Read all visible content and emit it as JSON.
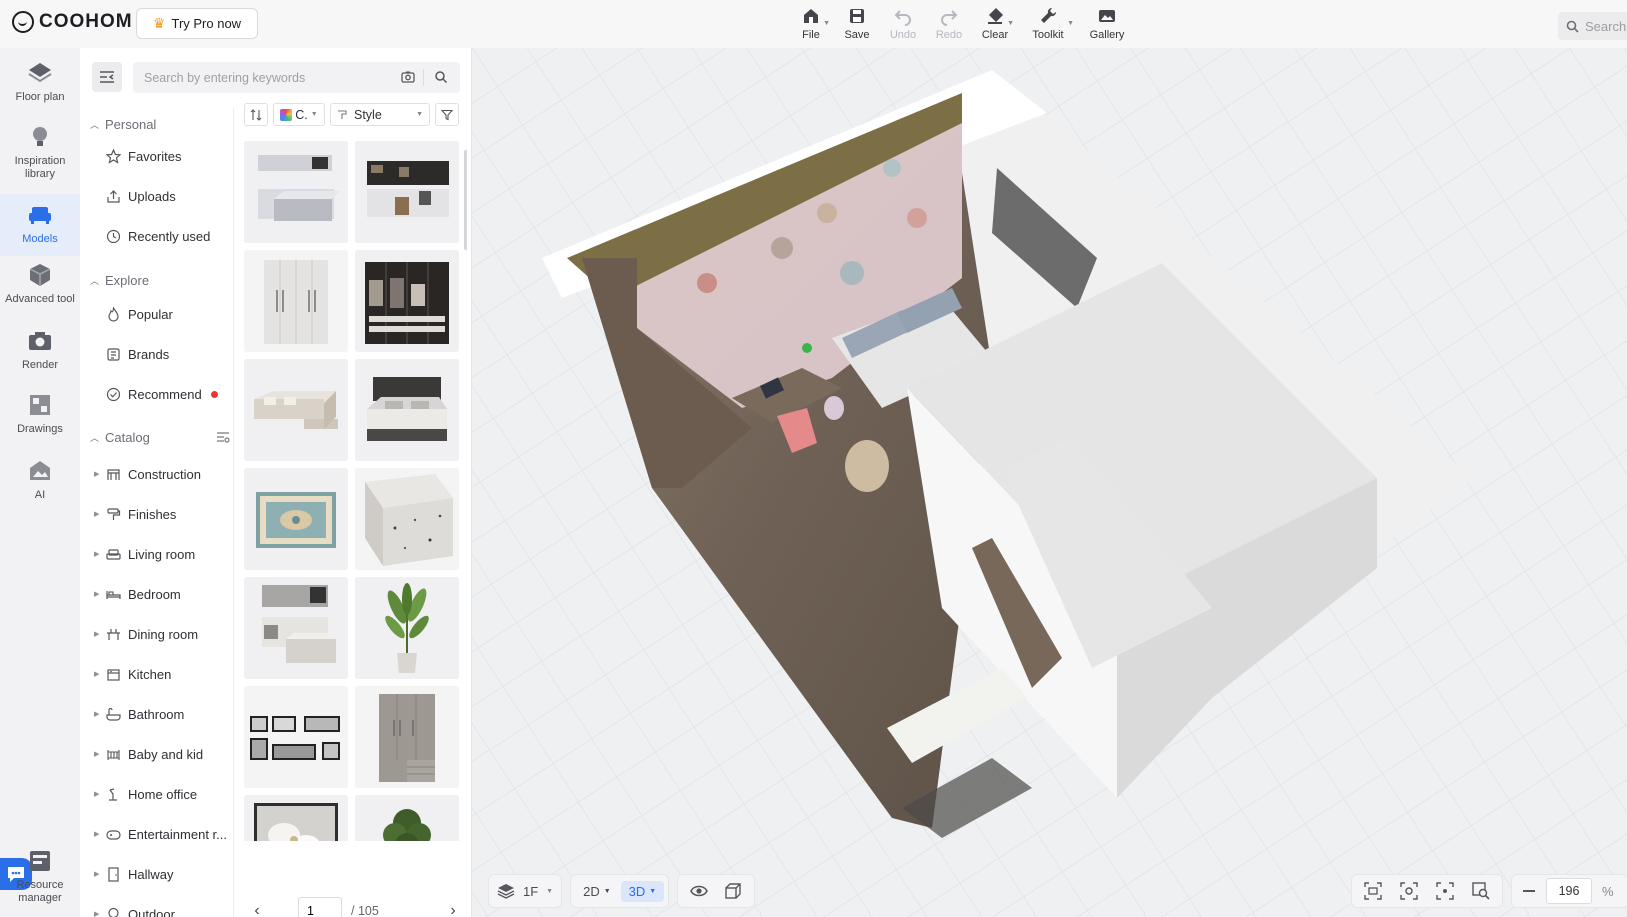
{
  "app": {
    "logo_text": "COOHOM",
    "try_pro_label": "Try Pro now"
  },
  "toolbar": {
    "file": "File",
    "save": "Save",
    "undo": "Undo",
    "redo": "Redo",
    "clear": "Clear",
    "toolkit": "Toolkit",
    "gallery": "Gallery"
  },
  "top_search": {
    "label": "Search"
  },
  "rail": {
    "floor_plan": "Floor plan",
    "inspiration": "Inspiration library",
    "models": "Models",
    "advanced_tool": "Advanced tool",
    "render": "Render",
    "drawings": "Drawings",
    "ai": "AI",
    "resource_manager": "Resource manager"
  },
  "panel": {
    "search_placeholder": "Search by entering keywords",
    "sections": {
      "personal": "Personal",
      "explore": "Explore",
      "catalog": "Catalog"
    },
    "personal": {
      "favorites": "Favorites",
      "uploads": "Uploads",
      "recently_used": "Recently used"
    },
    "explore": {
      "popular": "Popular",
      "brands": "Brands",
      "recommend": "Recommend"
    },
    "catalog": {
      "construction": "Construction",
      "finishes": "Finishes",
      "living_room": "Living room",
      "bedroom": "Bedroom",
      "dining_room": "Dining room",
      "kitchen": "Kitchen",
      "bathroom": "Bathroom",
      "baby_and_kid": "Baby and kid",
      "home_office": "Home office",
      "entertainment": "Entertainment r...",
      "hallway": "Hallway",
      "outdoor": "Outdoor"
    },
    "filters": {
      "color": "C.",
      "style": "Style"
    },
    "pager": {
      "current": "1",
      "total": "/ 105"
    }
  },
  "view": {
    "floor": "1F",
    "mode_2d": "2D",
    "mode_3d": "3D",
    "active_mode": "3D",
    "zoom_value": "196",
    "zoom_unit": "%"
  }
}
